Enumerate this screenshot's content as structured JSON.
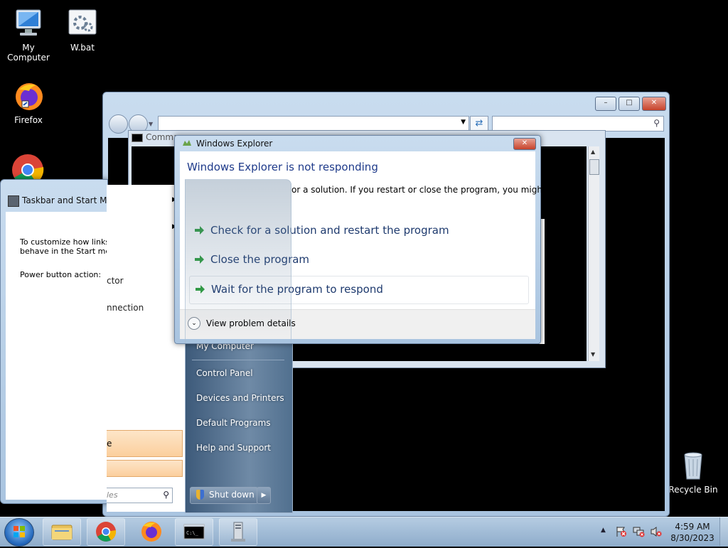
{
  "desktop": {
    "icons": [
      {
        "label": "My Computer",
        "icon": "computer-icon"
      },
      {
        "label": "W.bat",
        "icon": "batch-file-icon"
      },
      {
        "label": "Firefox",
        "icon": "firefox-icon"
      },
      {
        "label": "Recycle Bin",
        "icon": "recycle-bin-icon"
      }
    ]
  },
  "explorer": {
    "address_value": "",
    "search_value": ""
  },
  "cmd_window": {
    "title_partial": "Comma"
  },
  "dialog": {
    "title": "Windows Explorer",
    "heading": "Windows Explorer is not responding",
    "message_partial": "or a solution. If you restart or close the program, you might",
    "options": [
      "Check for a solution and restart the program",
      "Close the program",
      "Wait for the program to respond"
    ],
    "details_label": "View problem details"
  },
  "taskbar_props": {
    "title": "Taskbar and Start Men",
    "desc_line1": "To customize how links,",
    "desc_line2": "behave in the Start men",
    "power_label": "Power button action:"
  },
  "start_menu": {
    "left_items_partial": [
      "ctor",
      "nnection",
      "e"
    ],
    "search_placeholder": "les",
    "right_items": [
      "My Computer",
      "Control Panel",
      "Devices and Printers",
      "Default Programs",
      "Help and Support"
    ],
    "shutdown_label": "Shut down"
  },
  "taskbar": {
    "clock_time": "4:59 AM",
    "clock_date": "8/30/2023",
    "apps": [
      "file-explorer-icon",
      "chrome-icon",
      "firefox-icon",
      "cmd-icon",
      "server-icon"
    ]
  }
}
